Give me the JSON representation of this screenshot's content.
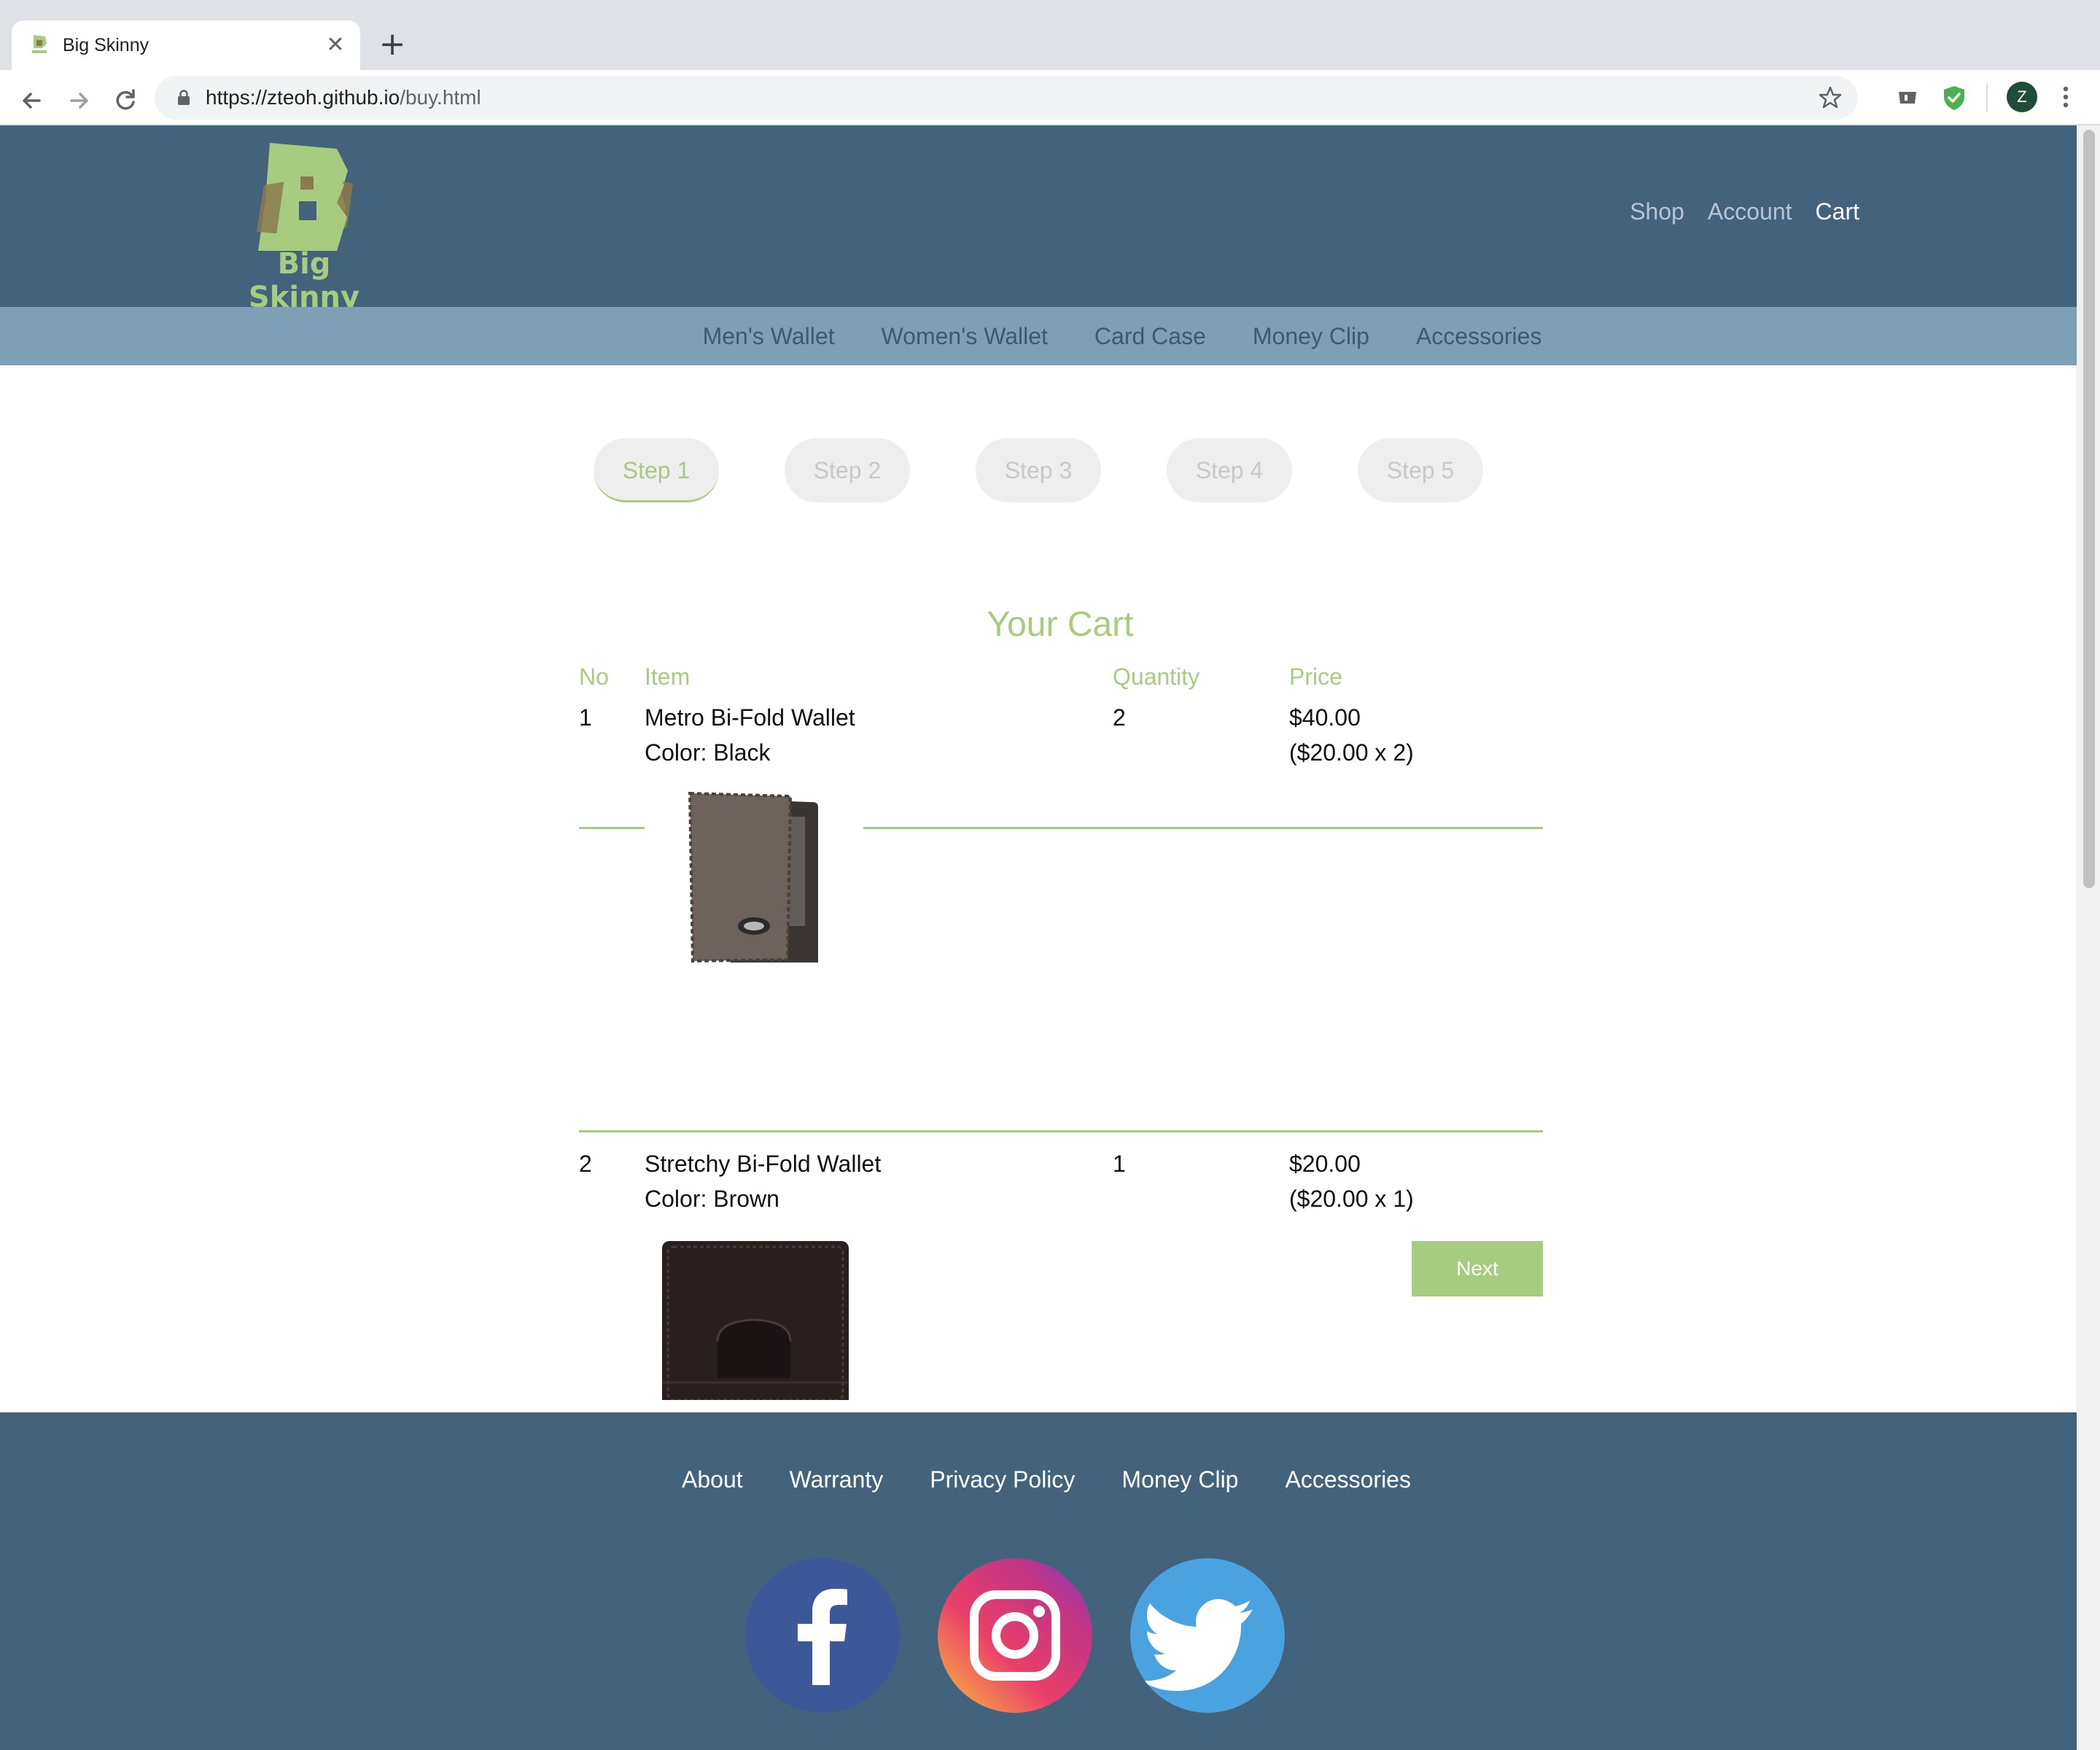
{
  "browser": {
    "tab_title": "Big Skinny",
    "tab_close": "✕",
    "new_tab": "+",
    "url_host": "https://zteoh.github.io",
    "url_path": "/buy.html",
    "profile_initial": "Z"
  },
  "header": {
    "logo_text": "Big Skinny",
    "nav": [
      "Shop",
      "Account",
      "Cart"
    ],
    "active_nav": "Cart"
  },
  "categories": [
    "Men's Wallet",
    "Women's Wallet",
    "Card Case",
    "Money Clip",
    "Accessories"
  ],
  "steps": {
    "labels": [
      "Step 1",
      "Step 2",
      "Step 3",
      "Step 4",
      "Step 5"
    ],
    "active_index": 0
  },
  "cart": {
    "title": "Your Cart",
    "columns": [
      "No",
      "Item",
      "Quantity",
      "Price"
    ],
    "rows": [
      {
        "no": "1",
        "item": "Metro Bi-Fold Wallet",
        "color": "Color: Black",
        "quantity": "2",
        "price": "$40.00",
        "price_detail": "($20.00 x 2)"
      },
      {
        "no": "2",
        "item": "Stretchy Bi-Fold Wallet",
        "color": "Color: Brown",
        "quantity": "1",
        "price": "$20.00",
        "price_detail": "($20.00 x 1)"
      }
    ],
    "next_label": "Next"
  },
  "footer": {
    "links": [
      "About",
      "Warranty",
      "Privacy Policy",
      "Money Clip",
      "Accessories"
    ],
    "social": [
      "facebook-icon",
      "instagram-icon",
      "twitter-icon"
    ]
  },
  "colors": {
    "header_bg": "#43627c",
    "category_bg": "#7f9fb6",
    "accent_green": "#a8cc7f",
    "facebook": "#3b5998",
    "twitter": "#4aa3df"
  }
}
